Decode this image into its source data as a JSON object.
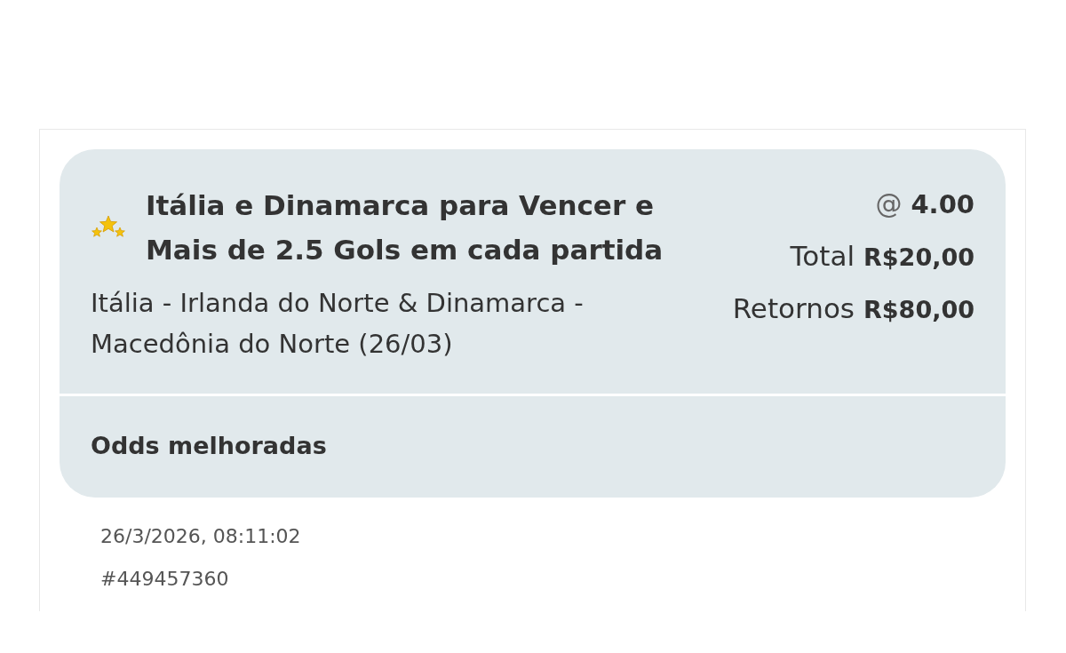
{
  "bet": {
    "title": "Itália e Dinamarca para Vencer e Mais de 2.5 Gols em cada partida",
    "description": "Itália - Irlanda do Norte & Dinamarca - Macedônia do Norte (26/03)",
    "odds_symbol": "@",
    "odds": "4.00",
    "amounts": [
      {
        "label": "Total",
        "value": "R$20,00"
      },
      {
        "label": "Retornos",
        "value": "R$80,00"
      }
    ],
    "tag": "Odds melhoradas"
  },
  "placed_at": "26/3/2026, 08:11:02",
  "reference": "#449457360"
}
